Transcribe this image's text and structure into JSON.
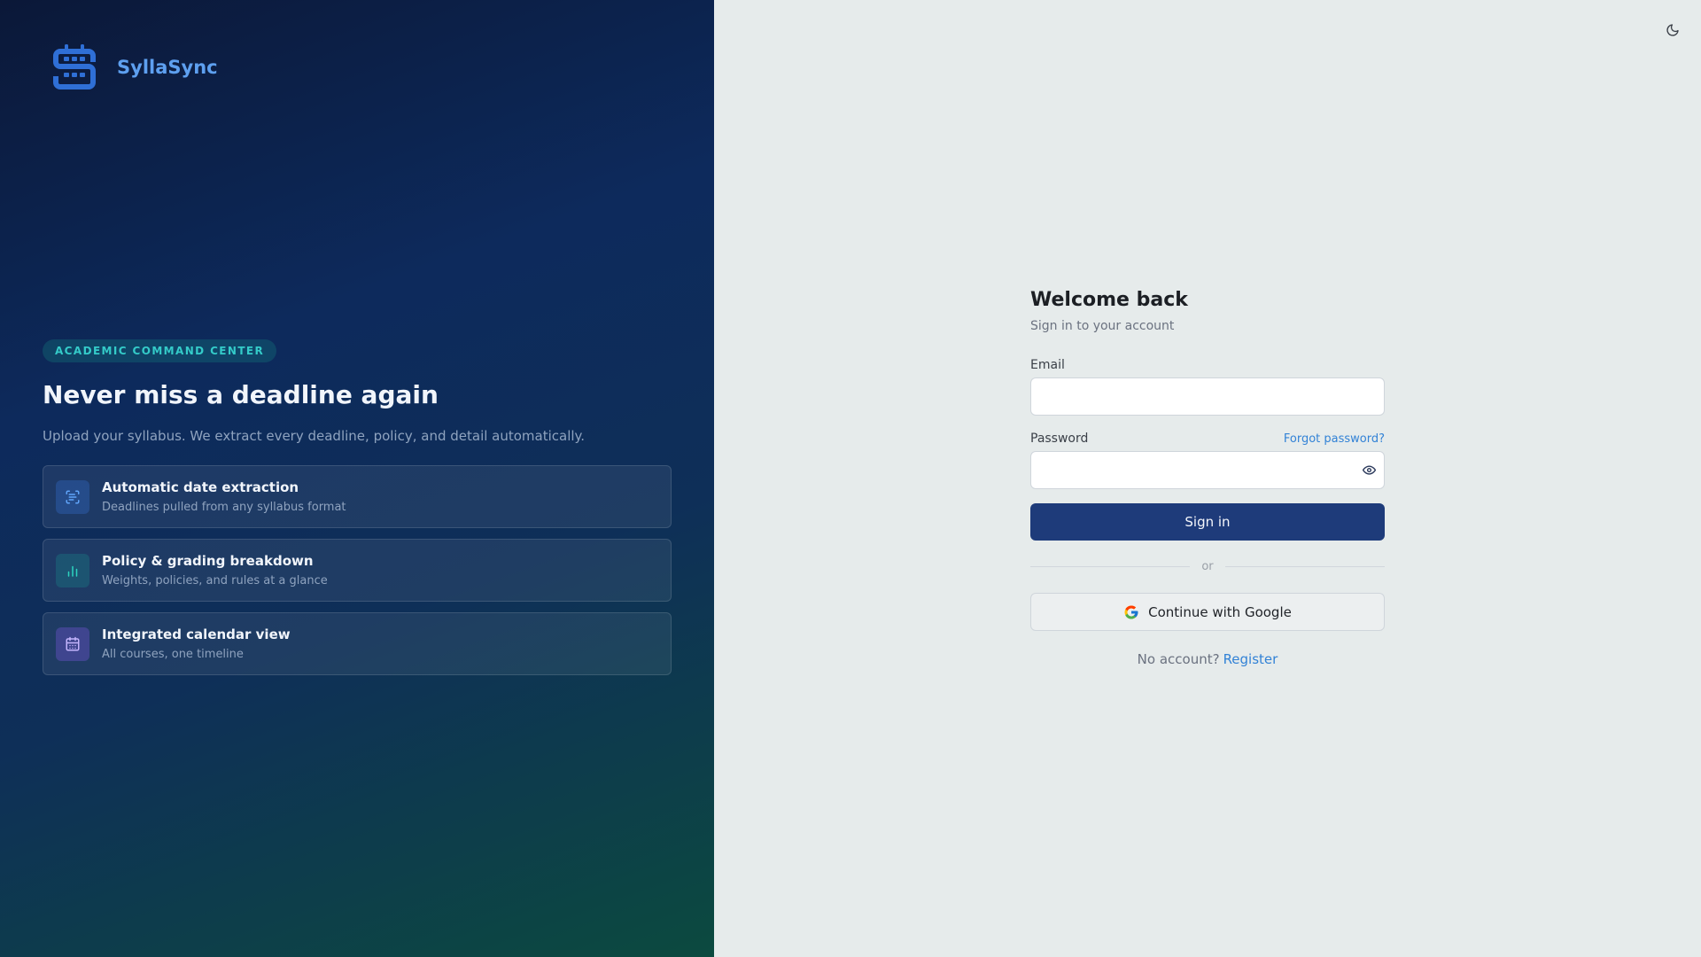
{
  "brand": {
    "name": "SyllaSync",
    "logo_icon": "calendar-s-logo-icon",
    "color": "#5ea0f0"
  },
  "hero": {
    "eyebrow": "ACADEMIC COMMAND CENTER",
    "headline": "Never miss a deadline again",
    "subline": "Upload your syllabus. We extract every deadline, policy, and detail automatically.",
    "features": [
      {
        "title": "Automatic date extraction",
        "description": "Deadlines pulled from any syllabus format",
        "icon": "scan-text-icon"
      },
      {
        "title": "Policy & grading breakdown",
        "description": "Weights, policies, and rules at a glance",
        "icon": "bar-chart-icon"
      },
      {
        "title": "Integrated calendar view",
        "description": "All courses, one timeline",
        "icon": "calendar-icon"
      }
    ]
  },
  "auth": {
    "theme_toggle_icon": "moon-icon",
    "title": "Welcome back",
    "subtitle": "Sign in to your account",
    "email": {
      "label": "Email",
      "value": "",
      "placeholder": ""
    },
    "password": {
      "label": "Password",
      "value": "",
      "placeholder": "",
      "forgot_label": "Forgot password?",
      "toggle_icon": "eye-icon"
    },
    "signin_label": "Sign in",
    "divider_text": "or",
    "google_label": "Continue with Google",
    "google_icon": "google-icon",
    "register_prompt": "No account?",
    "register_label": "Register"
  },
  "colors": {
    "primary_button": "#1e3b7a",
    "link": "#3282d6",
    "accent_teal": "#34cbc9",
    "panel_bg": "#e6ebeb"
  }
}
